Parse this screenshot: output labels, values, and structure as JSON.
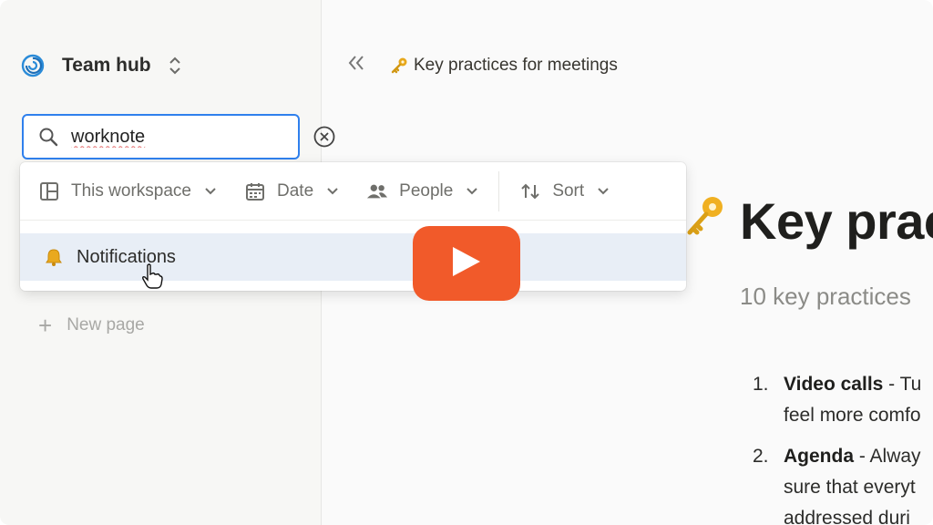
{
  "sidebar": {
    "workspace_name": "Team hub",
    "workspace_icon": "spiral-logo-icon",
    "search": {
      "value": "worknote",
      "placeholder": ""
    },
    "new_page_label": "New page"
  },
  "filters": [
    {
      "label": "This workspace",
      "icon": "layout-icon"
    },
    {
      "label": "Date",
      "icon": "calendar-icon"
    },
    {
      "label": "People",
      "icon": "people-icon"
    },
    {
      "label": "Sort",
      "icon": "sort-icon"
    }
  ],
  "search_results": [
    {
      "label": "Notifications",
      "icon": "bell-icon"
    }
  ],
  "topbar": {
    "breadcrumb": "Key practices for meetings"
  },
  "page": {
    "title": "Key prac",
    "subtitle": "10 key practices",
    "list": [
      {
        "num": "1.",
        "bold": "Video calls",
        "text": " - Tu",
        "cont": "feel more comfo"
      },
      {
        "num": "2.",
        "bold": "Agenda",
        "text": " - Alway",
        "cont": "sure that everyt",
        "cont2": "addressed duri"
      }
    ]
  },
  "colors": {
    "accent": "#2f80ed",
    "play_button": "#f15a2a",
    "result_highlight": "#e8eef6"
  }
}
